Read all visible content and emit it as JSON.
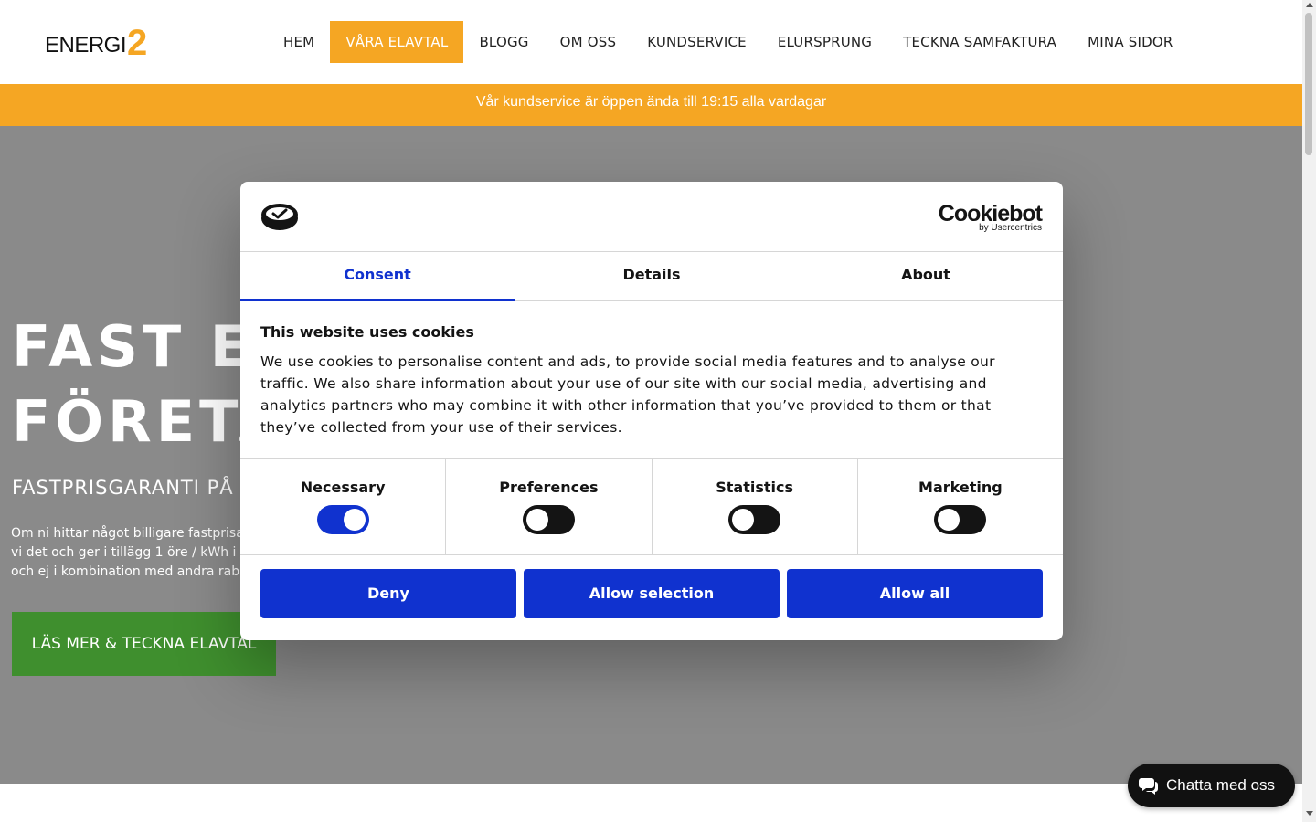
{
  "header": {
    "logo_text": "ENERGI",
    "logo_number": "2",
    "nav": [
      {
        "label": "HEM",
        "active": false
      },
      {
        "label": "VÅRA ELAVTAL",
        "active": true
      },
      {
        "label": "BLOGG",
        "active": false
      },
      {
        "label": "OM OSS",
        "active": false
      },
      {
        "label": "KUNDSERVICE",
        "active": false
      },
      {
        "label": "ELURSPRUNG",
        "active": false
      },
      {
        "label": "TECKNA SAMFAKTURA",
        "active": false
      },
      {
        "label": "MINA SIDOR",
        "active": false
      }
    ]
  },
  "notice": "Vår kundservice är öppen ända till 19:15 alla vardagar",
  "hero": {
    "title": "FAST EL\nFÖRETA",
    "subtitle": "FASTPRISGARANTI PÅ E",
    "body": "Om ni hittar något billigare fastprisa\nvi det och ger i tillägg 1 öre / kWh i e\noch ej i kombination med andra raba",
    "cta": "LÄS MER & TECKNA ELAVTAL"
  },
  "cookie_dialog": {
    "brand": "Cookiebot",
    "brand_by": "by Usercentrics",
    "tabs": [
      {
        "label": "Consent",
        "active": true
      },
      {
        "label": "Details",
        "active": false
      },
      {
        "label": "About",
        "active": false
      }
    ],
    "title": "This website uses cookies",
    "text": "We use cookies to personalise content and ads, to provide social media features and to analyse our traffic. We also share information about your use of our site with our social media, advertising and analytics partners who may combine it with other information that you’ve provided to them or that they’ve collected from your use of their services.",
    "toggles": [
      {
        "label": "Necessary",
        "on": true
      },
      {
        "label": "Preferences",
        "on": false
      },
      {
        "label": "Statistics",
        "on": false
      },
      {
        "label": "Marketing",
        "on": false
      }
    ],
    "buttons": {
      "deny": "Deny",
      "allow_selection": "Allow selection",
      "allow_all": "Allow all"
    }
  },
  "chat": {
    "label": "Chatta med oss",
    "icon": "chat-bubbles-icon"
  },
  "colors": {
    "accent_orange": "#f5a623",
    "cta_green": "#3f8f2e",
    "consent_blue": "#1032cf",
    "hero_gray": "#8a8a8a"
  }
}
